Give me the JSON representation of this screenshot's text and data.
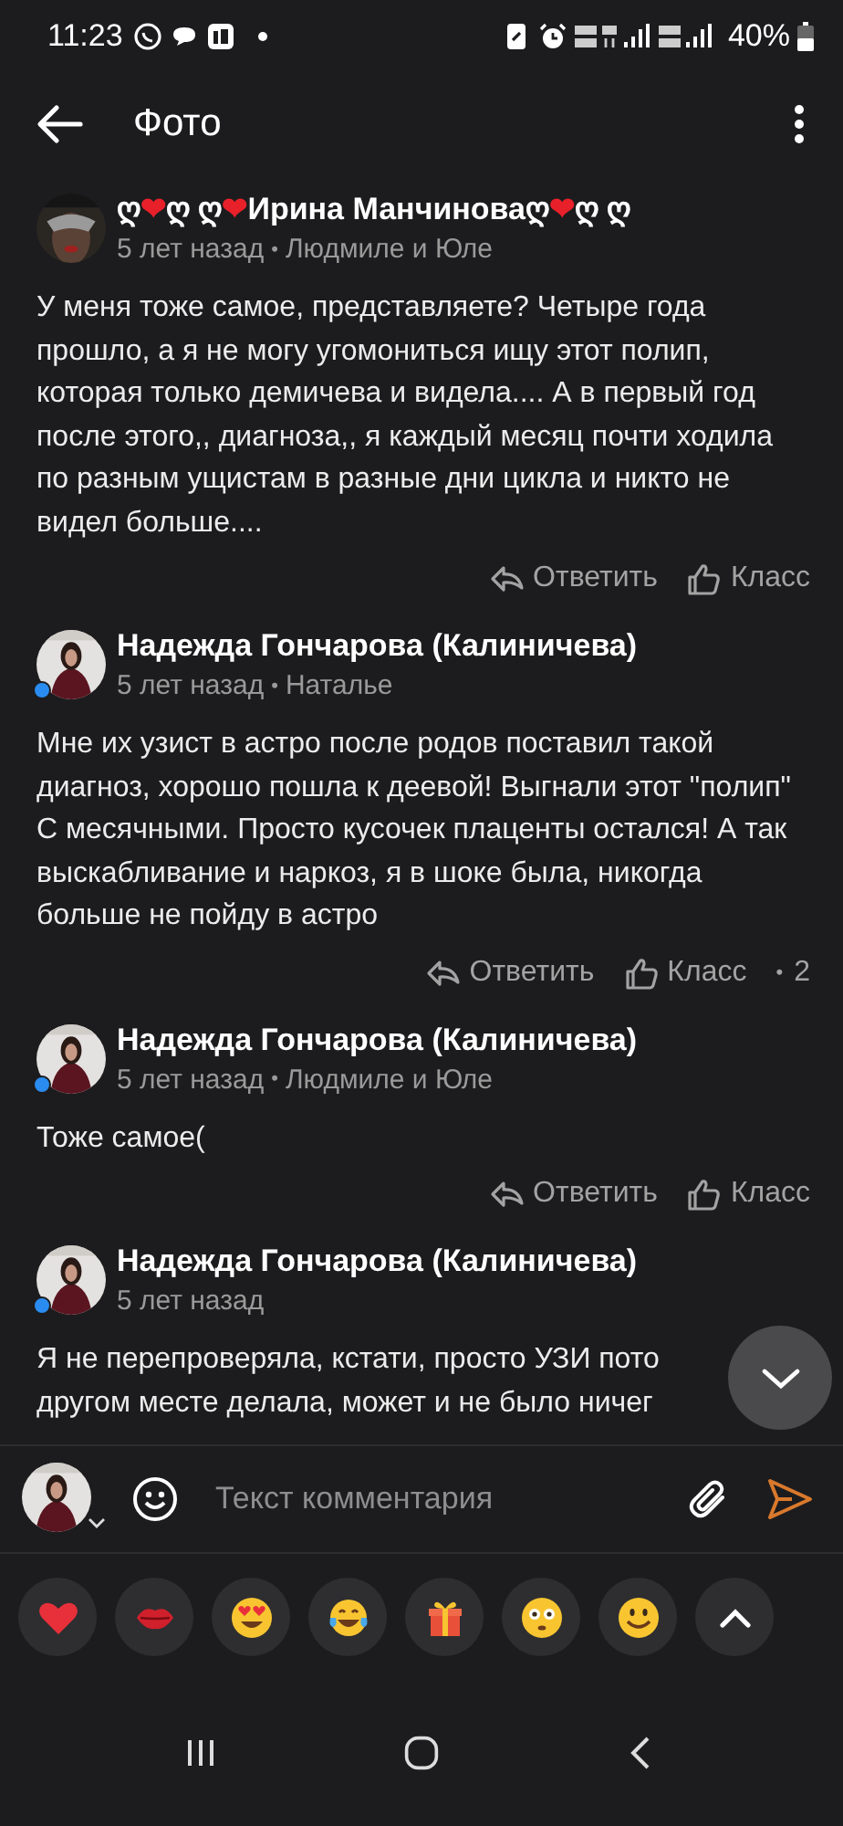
{
  "status_bar": {
    "time": "11:23",
    "battery": "40%"
  },
  "app_bar": {
    "title": "Фото"
  },
  "comments": [
    {
      "author_segments": [
        {
          "kind": "text",
          "text": "ღ"
        },
        {
          "kind": "heart",
          "text": "❤"
        },
        {
          "kind": "text",
          "text": "ღ ღ"
        },
        {
          "kind": "heart",
          "text": "❤"
        },
        {
          "kind": "text",
          "text": "Ирина Манчиноваღ"
        },
        {
          "kind": "heart",
          "text": "❤"
        },
        {
          "kind": "text",
          "text": "ღ ღ"
        }
      ],
      "online": false,
      "time": "5 лет назад",
      "separator": "•",
      "recipient": "Людмиле и Юле",
      "text": "У меня тоже самое, представляете? Четыре года прошло, а я не могу угомониться ищу этот полип, которая только демичева и видела.... А в первый год после этого,, диагноза,, я каждый месяц почти ходила по разным ущистам в разные дни цикла и никто не видел больше....",
      "reply": "Ответить",
      "like": "Класс"
    },
    {
      "author_segments": [
        {
          "kind": "text",
          "text": "Надежда Гончарова (Калиничева)"
        }
      ],
      "online": true,
      "time": "5 лет назад",
      "separator": "•",
      "recipient": "Наталье",
      "text": "Мне их узист в астро после родов поставил такой диагноз, хорошо пошла к деевой! Выгнали этот \"полип\"  С месячными. Просто кусочек плаценты остался! А так выскабливание и наркоз, я в шоке была, никогда больше не пойду в астро",
      "reply": "Ответить",
      "like": "Класс",
      "count_separator": "•",
      "like_count": "2"
    },
    {
      "author_segments": [
        {
          "kind": "text",
          "text": "Надежда Гончарова (Калиничева)"
        }
      ],
      "online": true,
      "time": "5 лет назад",
      "separator": "•",
      "recipient": "Людмиле и Юле",
      "text": "Тоже самое(",
      "reply": "Ответить",
      "like": "Класс"
    },
    {
      "author_segments": [
        {
          "kind": "text",
          "text": "Надежда Гончарова (Калиничева)"
        }
      ],
      "online": true,
      "time": "5 лет назад",
      "text": "Я не перепроверяла, кстати, просто УЗИ пото другом месте делала, может и не было ничег"
    }
  ],
  "composer": {
    "placeholder": "Текст комментария"
  },
  "reactions": [
    {
      "kind": "heart"
    },
    {
      "kind": "lips"
    },
    {
      "kind": "heart-eyes"
    },
    {
      "kind": "tears-of-joy"
    },
    {
      "kind": "gift"
    },
    {
      "kind": "flushed"
    },
    {
      "kind": "smile"
    },
    {
      "kind": "expand"
    }
  ]
}
